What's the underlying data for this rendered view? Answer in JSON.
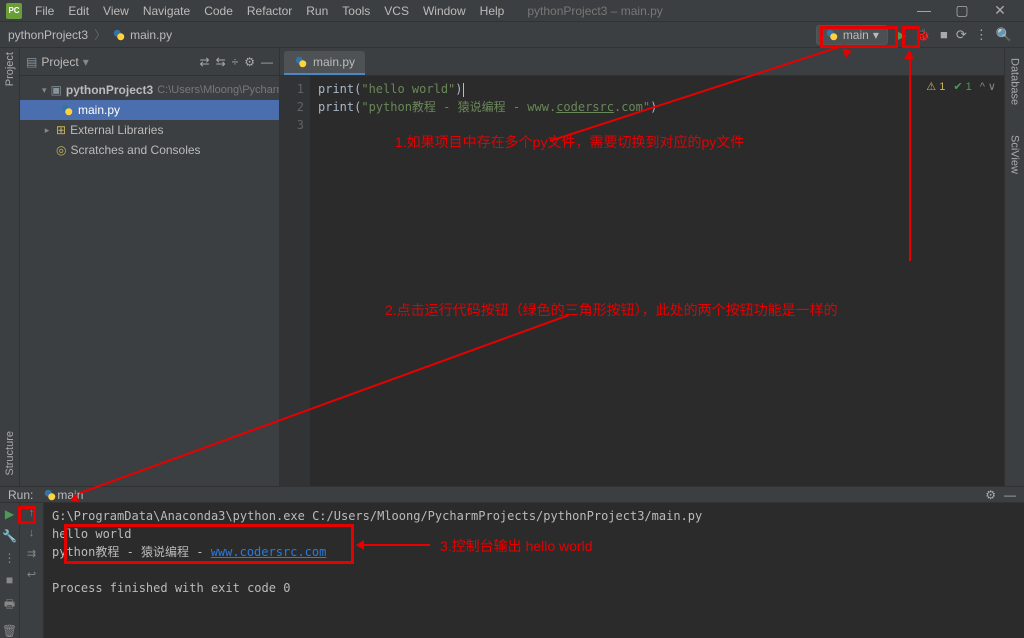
{
  "titlebar": {
    "app_icon_text": "PC",
    "menus": [
      "File",
      "Edit",
      "View",
      "Navigate",
      "Code",
      "Refactor",
      "Run",
      "Tools",
      "VCS",
      "Window",
      "Help"
    ],
    "title": "pythonProject3 – main.py"
  },
  "breadcrumb": {
    "project": "pythonProject3",
    "file": "main.py"
  },
  "run_config": {
    "label": "main",
    "dropdown_glyph": "▾"
  },
  "toolbar_right_icons": {
    "run": "▶",
    "debug": "🐞",
    "stop": "■",
    "more1": "⟳",
    "more2": "⋮",
    "search": "🔍"
  },
  "project_panel": {
    "title": "Project",
    "toolbar_icons": [
      "⇄",
      "⇆",
      "÷",
      "⚙",
      "—",
      "⋮"
    ],
    "root": {
      "name": "pythonProject3",
      "path": "C:\\Users\\Mloong\\PycharmProjects\\"
    },
    "file": "main.py",
    "ext_lib": "External Libraries",
    "scratches": "Scratches and Consoles"
  },
  "left_strip": {
    "project": "Project",
    "structure": "Structure"
  },
  "right_strip": {
    "database": "Database",
    "sciview": "SciView"
  },
  "editor": {
    "tab": "main.py",
    "lines": [
      "1",
      "2",
      "3"
    ],
    "code": {
      "l1": "",
      "l2_fn": "print",
      "l2_str": "\"hello world\"",
      "l3_fn": "print",
      "l3_str_a": "\"python教程 - 猿说编程 - www.",
      "l3_str_url": "codersrc",
      "l3_str_b": ".com\""
    },
    "status": {
      "warn": "⚠ 1",
      "ok": "✔ 1",
      "chev": "^   ∨"
    }
  },
  "run_tw": {
    "title": "Run:",
    "config": "main",
    "console": {
      "cmd": "G:\\ProgramData\\Anaconda3\\python.exe C:/Users/Mloong/PycharmProjects/pythonProject3/main.py",
      "out1": "hello world",
      "out2_a": "python教程 - 猿说编程 - ",
      "out2_url": "www.codersrc.com",
      "exit": "Process finished with exit code 0"
    },
    "left_icons": {
      "play": "▶",
      "tools": "🔧",
      "dots": "⋮",
      "stop": "■",
      "print": "🖶",
      "trash": "🗑"
    },
    "left2_icons": {
      "up": "↑",
      "down": "↓",
      "soft": "⇉",
      "wrap": "↩"
    },
    "right_icons": {
      "gear": "⚙",
      "min": "—"
    }
  },
  "annotations": {
    "a1": "1.如果项目中存在多个py文件，需要切换到对应的py文件",
    "a2": "2.点击运行代码按钮（绿色的三角形按钮），此处的两个按钮功能是一样的",
    "a3": "3.控制台输出 hello world"
  }
}
